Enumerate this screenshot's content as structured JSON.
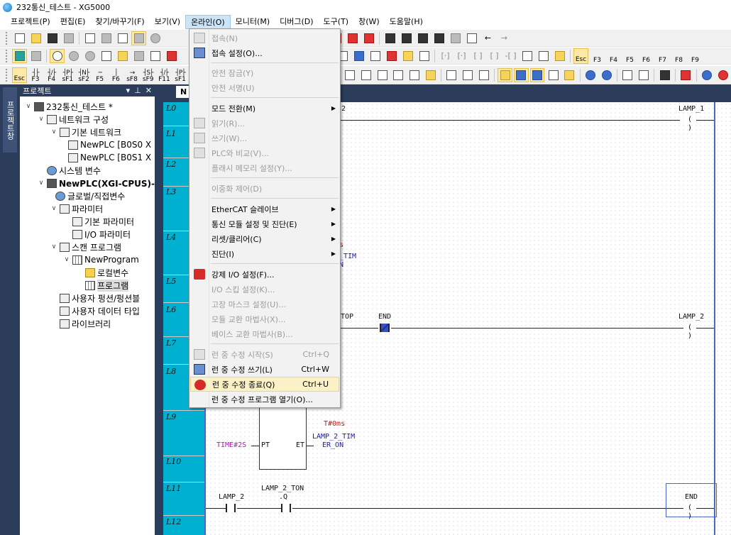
{
  "window": {
    "title": "232통신_테스트 - XG5000"
  },
  "menubar": [
    "프로젝트(P)",
    "편집(E)",
    "찾기/바꾸기(F)",
    "보기(V)",
    "온라인(O)",
    "모니터(M)",
    "디버그(D)",
    "도구(T)",
    "창(W)",
    "도움말(H)"
  ],
  "fkeys": [
    {
      "sym": "",
      "lbl": "Esc"
    },
    {
      "sym": "┤├",
      "lbl": "F3"
    },
    {
      "sym": "┤/├",
      "lbl": "F4"
    },
    {
      "sym": "┤P├",
      "lbl": "sF1"
    },
    {
      "sym": "┤N├",
      "lbl": "sF2"
    },
    {
      "sym": "─",
      "lbl": "F5"
    },
    {
      "sym": "│",
      "lbl": "F6"
    },
    {
      "sym": "→",
      "lbl": "sF8"
    },
    {
      "sym": "┤S├",
      "lbl": "sF9"
    },
    {
      "sym": "┤/├",
      "lbl": "F11"
    },
    {
      "sym": "┤P├",
      "lbl": "sF1"
    }
  ],
  "fkeys_right": [
    "Esc",
    "F3",
    "F4",
    "F5",
    "F6",
    "F7",
    "F8",
    "F9"
  ],
  "leftstrip": {
    "tab": "프로젝트창"
  },
  "project_panel": {
    "title": "프로젝트",
    "items": [
      {
        "label": "232통신_테스트 *"
      },
      {
        "label": "네트워크 구성"
      },
      {
        "label": "기본 네트워크"
      },
      {
        "label": "NewPLC [B0S0 X"
      },
      {
        "label": "NewPLC [B0S1 X"
      },
      {
        "label": "시스템 변수"
      },
      {
        "label": "NewPLC(XGI-CPUS)-런"
      },
      {
        "label": "글로벌/직접변수"
      },
      {
        "label": "파라미터"
      },
      {
        "label": "기본 파라미터"
      },
      {
        "label": "I/O 파라미터"
      },
      {
        "label": "스캔 프로그램"
      },
      {
        "label": "NewProgram"
      },
      {
        "label": "로컬변수"
      },
      {
        "label": "프로그램"
      },
      {
        "label": "사용자 펑션/펑션블"
      },
      {
        "label": "사용자 데이터 타입"
      },
      {
        "label": "라이브러리"
      }
    ]
  },
  "editor": {
    "tab": "N",
    "rungs": [
      "L0",
      "L1",
      "L2",
      "L3",
      "L4",
      "L5",
      "L6",
      "L7",
      "L8",
      "L9",
      "L10",
      "L11",
      "L12"
    ],
    "ladder": {
      "l0_contact": "2",
      "lamp1": "LAMP_1",
      "l4_s": "s",
      "l4_tim": "_TIM",
      "l4_n": "N",
      "l6_top": "TOP",
      "l6_end": "END",
      "lamp2": "LAMP_2",
      "t0ms": "T#0ms",
      "time2s": "TIME#2S",
      "pt": "PT",
      "et": "ET",
      "lamp2tim": "LAMP_2_TIM",
      "eron": "ER_ON",
      "l11_lamp2": "LAMP_2",
      "l11_ton": "LAMP_2_TON",
      "l11_q": ".Q",
      "end": "END",
      "coil_sym": "( )"
    }
  },
  "dropdown": {
    "items": [
      {
        "label": "접속(N)",
        "disabled": true
      },
      {
        "label": "접속 설정(O)...",
        "disabled": false
      },
      {
        "label": "안전 잠금(Y)",
        "disabled": true
      },
      {
        "label": "안전 서명(U)",
        "disabled": true
      },
      {
        "label": "모드 전환(M)",
        "disabled": false,
        "submenu": true
      },
      {
        "label": "읽기(R)...",
        "disabled": true
      },
      {
        "label": "쓰기(W)...",
        "disabled": true
      },
      {
        "label": "PLC와 비교(V)...",
        "disabled": true
      },
      {
        "label": "플래시 메모리 설정(Y)...",
        "disabled": true
      },
      {
        "label": "이중화 제어(D)",
        "disabled": true
      },
      {
        "label": "EtherCAT 슬레이브",
        "disabled": false,
        "submenu": true
      },
      {
        "label": "통신 모듈 설정 및 진단(E)",
        "disabled": false,
        "submenu": true
      },
      {
        "label": "리셋/클리어(C)",
        "disabled": false,
        "submenu": true
      },
      {
        "label": "진단(I)",
        "disabled": false,
        "submenu": true
      },
      {
        "label": "강제 I/O 설정(F)...",
        "disabled": false
      },
      {
        "label": "I/O 스킵 설정(K)...",
        "disabled": true
      },
      {
        "label": "고장 마스크 설정(U)...",
        "disabled": true
      },
      {
        "label": "모듈 교환 마법사(X)...",
        "disabled": true
      },
      {
        "label": "베이스 교환 마법사(B)...",
        "disabled": true
      },
      {
        "label": "런 중 수정 시작(S)",
        "disabled": true,
        "shortcut": "Ctrl+Q"
      },
      {
        "label": "런 중 수정 쓰기(L)",
        "disabled": false,
        "shortcut": "Ctrl+W"
      },
      {
        "label": "런 중 수정 종료(Q)",
        "disabled": false,
        "shortcut": "Ctrl+U",
        "highlighted": true
      },
      {
        "label": "런 중 수정 프로그램 열기(O)...",
        "disabled": false
      }
    ]
  },
  "colors": {
    "rung_column": "#00b0d0",
    "panel_dark": "#2b3d5a",
    "rail": "#4a68c8",
    "menu_highlight": "#fbf1c7"
  }
}
